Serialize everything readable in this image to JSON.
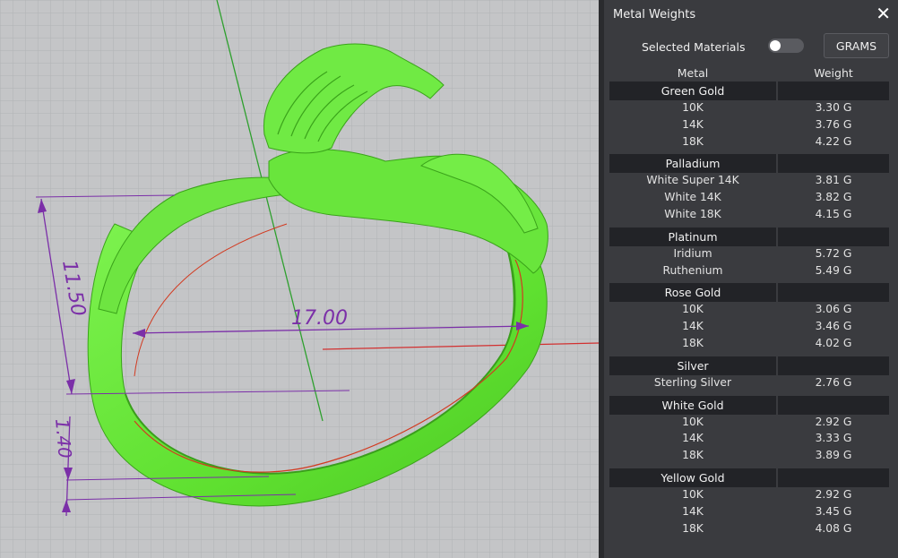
{
  "viewport": {
    "dimensions": {
      "height": "11.50",
      "width": "17.00",
      "thickness": "1.40"
    },
    "colors": {
      "background": "#c4c5c7",
      "grid": "#b0b1b3",
      "model": "#66e83a",
      "dimension": "#7b2fa8",
      "axis_y": "#2ea02e",
      "axis_x": "#d23030"
    }
  },
  "panel": {
    "title": "Metal Weights",
    "close_icon": "close-icon",
    "selected_materials_label": "Selected Materials",
    "toggle_state": "off",
    "units_button": "GRAMS",
    "col_metal": "Metal",
    "col_weight": "Weight",
    "groups": [
      {
        "name": "Green Gold",
        "rows": [
          {
            "metal": "10K",
            "weight": "3.30 G"
          },
          {
            "metal": "14K",
            "weight": "3.76 G"
          },
          {
            "metal": "18K",
            "weight": "4.22 G"
          }
        ]
      },
      {
        "name": "Palladium",
        "rows": [
          {
            "metal": "White Super 14K",
            "weight": "3.81 G"
          },
          {
            "metal": "White 14K",
            "weight": "3.82 G"
          },
          {
            "metal": "White 18K",
            "weight": "4.15 G"
          }
        ]
      },
      {
        "name": "Platinum",
        "rows": [
          {
            "metal": "Iridium",
            "weight": "5.72 G"
          },
          {
            "metal": "Ruthenium",
            "weight": "5.49 G"
          }
        ]
      },
      {
        "name": "Rose Gold",
        "rows": [
          {
            "metal": "10K",
            "weight": "3.06 G"
          },
          {
            "metal": "14K",
            "weight": "3.46 G"
          },
          {
            "metal": "18K",
            "weight": "4.02 G"
          }
        ]
      },
      {
        "name": "Silver",
        "rows": [
          {
            "metal": "Sterling Silver",
            "weight": "2.76 G"
          }
        ]
      },
      {
        "name": "White Gold",
        "rows": [
          {
            "metal": "10K",
            "weight": "2.92 G"
          },
          {
            "metal": "14K",
            "weight": "3.33 G"
          },
          {
            "metal": "18K",
            "weight": "3.89 G"
          }
        ]
      },
      {
        "name": "Yellow Gold",
        "rows": [
          {
            "metal": "10K",
            "weight": "2.92 G"
          },
          {
            "metal": "14K",
            "weight": "3.45 G"
          },
          {
            "metal": "18K",
            "weight": "4.08 G"
          }
        ]
      }
    ]
  }
}
